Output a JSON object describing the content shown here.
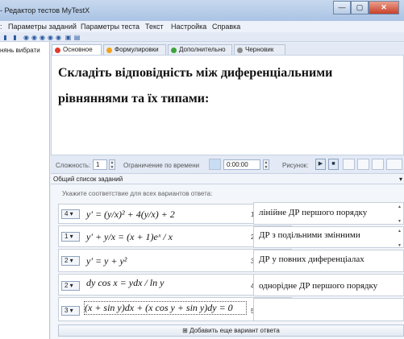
{
  "window": {
    "title": "- Редактор тестов MyTestX",
    "minimize": "—",
    "maximize": "▢",
    "close": "✕"
  },
  "menu": {
    "items": [
      "Параметры заданий",
      "Параметры теста",
      "Текст",
      "Настройка",
      "Справка"
    ]
  },
  "left_panel": {
    "label": "нянь вибрати"
  },
  "tabs": [
    {
      "label": "Основное",
      "color": "#e03c2c"
    },
    {
      "label": "Формулировки",
      "color": "#f0a21e"
    },
    {
      "label": "Дополнительно",
      "color": "#3da53a"
    },
    {
      "label": "Черновик",
      "color": "#8a8a8a"
    }
  ],
  "question_text": "Складіть відповідність між диференціальними рівняннями та їх типами:",
  "options_row": {
    "difficulty_label": "Сложность:",
    "difficulty_value": "1",
    "time_limit_label": "Ограничение по времени",
    "time_value": "0:00:00",
    "picture_label": "Рисунок:"
  },
  "list_header": "Общий список заданий",
  "hint": "Укажите соответствие для всех вариантов ответа:",
  "left_items": [
    {
      "choice": "4",
      "formula": "y′ = (y/x)² + 4(y/x) + 2",
      "index": "1"
    },
    {
      "choice": "1",
      "formula": "y′ + y/x = (x + 1)eˣ / x",
      "index": "2"
    },
    {
      "choice": "2",
      "formula": "y′ = y + y²",
      "index": "3"
    },
    {
      "choice": "2",
      "formula": "dy cos x = ydx / ln y",
      "index": "4"
    },
    {
      "choice": "3",
      "formula": "(x + sin y)dx + (x cos y + sin y)dy = 0",
      "index": "5"
    }
  ],
  "right_items": [
    {
      "text": "лінійне ДР першого порядку"
    },
    {
      "text": "ДР з подільними змінними"
    },
    {
      "text": "ДР у повних диференціалах"
    },
    {
      "text": "однорідне ДР першого порядку"
    },
    {
      "text": ""
    }
  ],
  "add_button": "⊞ Добавить еще вариант ответа"
}
